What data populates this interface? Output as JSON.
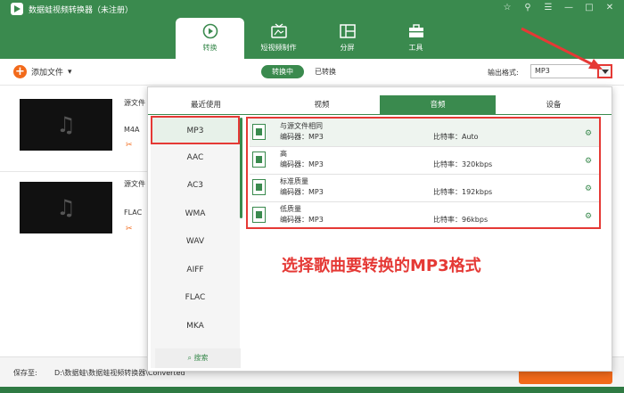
{
  "app": {
    "title": "数据蛙视频转换器（未注册）"
  },
  "window_controls": [
    "☆",
    "⚲",
    "☰",
    "—",
    "□",
    "✕"
  ],
  "nav": [
    {
      "label": "转换",
      "icon": "convert-icon",
      "active": true
    },
    {
      "label": "短视频制作",
      "icon": "tv-icon",
      "active": false
    },
    {
      "label": "分屏",
      "icon": "split-screen-icon",
      "active": false
    },
    {
      "label": "工具",
      "icon": "toolbox-icon",
      "active": false
    }
  ],
  "toolbar": {
    "add_file": "添加文件",
    "tab_converting": "转换中",
    "tab_converted": "已转换",
    "output_format_label": "输出格式:",
    "output_format_value": "MP3"
  },
  "files": [
    {
      "source_label": "源文件",
      "format": "M4A"
    },
    {
      "source_label": "源文件",
      "format": "FLAC"
    }
  ],
  "bottom": {
    "save_to_label": "保存至:",
    "save_path": "D:\\数据蛙\\数据蛙视频转换器\\Converted"
  },
  "format_panel": {
    "tabs": [
      "最近使用",
      "视频",
      "音频",
      "设备"
    ],
    "active_tab": 2,
    "formats": [
      "MP3",
      "AAC",
      "AC3",
      "WMA",
      "WAV",
      "AIFF",
      "FLAC",
      "MKA"
    ],
    "selected_format": 0,
    "search_label": "搜索",
    "qualities": [
      {
        "name": "与源文件相同",
        "encoder": "编码器：MP3",
        "bitrate": "比特率：Auto"
      },
      {
        "name": "高",
        "encoder": "编码器：MP3",
        "bitrate": "比特率：320kbps"
      },
      {
        "name": "标准质量",
        "encoder": "编码器：MP3",
        "bitrate": "比特率：192kbps"
      },
      {
        "name": "低质量",
        "encoder": "编码器：MP3",
        "bitrate": "比特率：96kbps"
      }
    ]
  },
  "annotation": "选择歌曲要转换的MP3格式",
  "colors": {
    "brand": "#3a8a4e",
    "accent": "#f26a1b",
    "highlight": "#e53935"
  }
}
